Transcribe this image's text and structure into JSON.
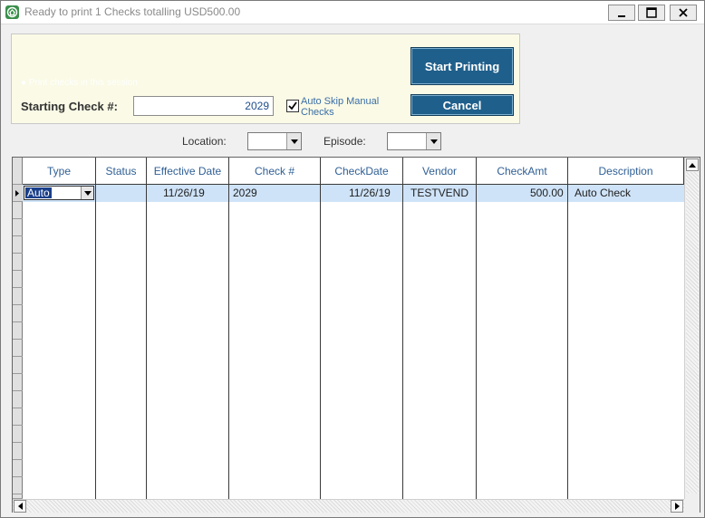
{
  "window": {
    "title": "Ready to print 1 Checks totalling USD500.00",
    "icon": "app-house-icon",
    "controls": [
      "minimize-icon",
      "maximize-icon",
      "close-icon"
    ]
  },
  "header": {
    "faint_note": "● Print checks in this session",
    "starting_check_label": "Starting Check #:",
    "starting_check_value": "2029",
    "auto_skip_label": "Auto Skip Manual Checks",
    "auto_skip_checked": true,
    "start_button": "Start Printing",
    "cancel_button": "Cancel"
  },
  "filters": {
    "location_label": "Location:",
    "location_value": "",
    "episode_label": "Episode:",
    "episode_value": ""
  },
  "grid": {
    "columns": [
      "Type",
      "Status",
      "Effective Date",
      "Check #",
      "CheckDate",
      "Vendor",
      "CheckAmt",
      "Description"
    ],
    "rows": [
      {
        "type": "Auto",
        "status": "",
        "effective_date": "11/26/19",
        "check_no": "2029",
        "check_date": "11/26/19",
        "vendor": "TESTVEND",
        "check_amt": "500.00",
        "description": "Auto Check"
      }
    ]
  },
  "colors": {
    "button_bg": "#1f5f8b",
    "header_panel_bg": "#fafae6",
    "selected_row_bg": "#cfe3f8",
    "column_header_text": "#2f5f95"
  }
}
